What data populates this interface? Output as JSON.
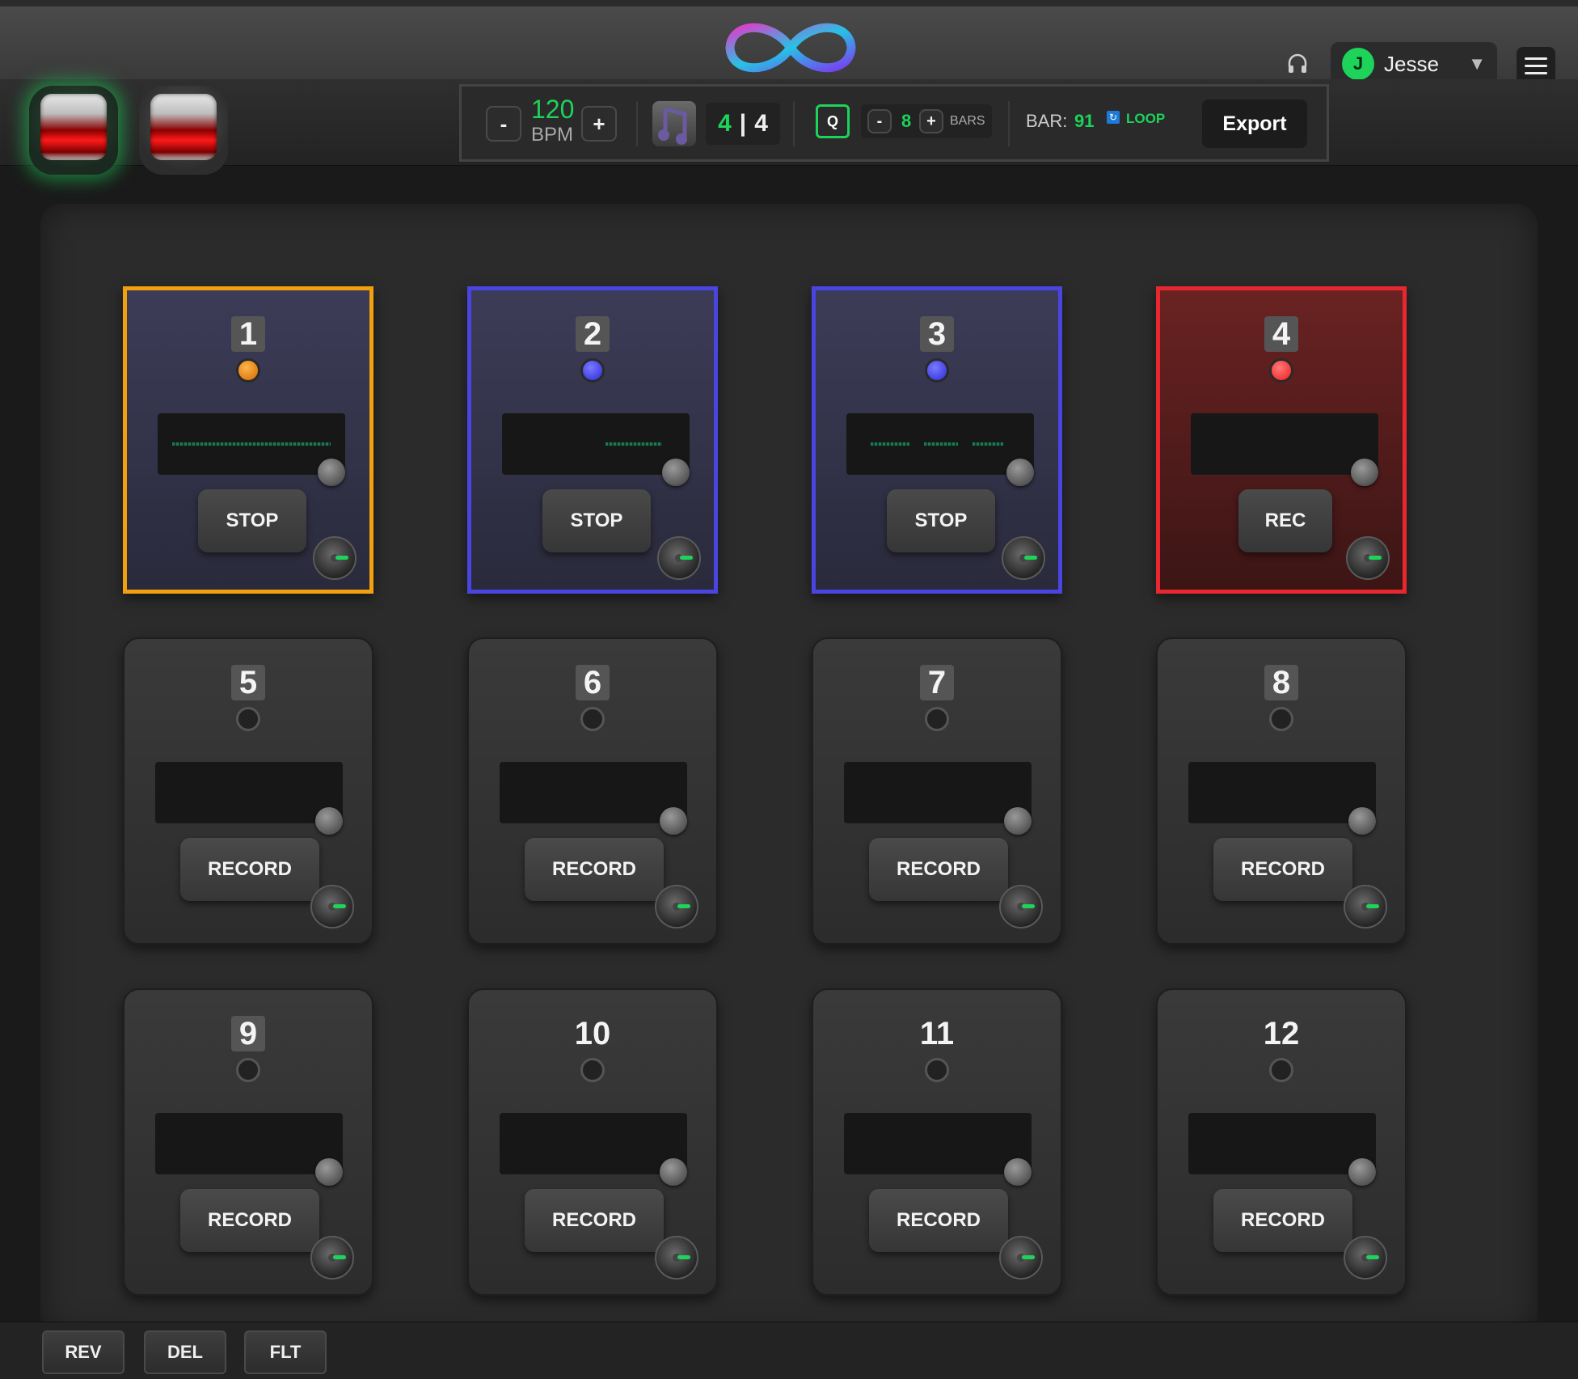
{
  "colors": {
    "accent_green": "#1dd35a",
    "orange": "#f1a10d",
    "blue": "#4a45e0",
    "red": "#e7282f"
  },
  "header": {
    "logo_icon": "infinity-icon",
    "headphones_icon": "headphones-icon",
    "user": {
      "avatar_letter": "J",
      "name": "Jesse",
      "caret": "▼"
    },
    "menu_icon": "hamburger-icon"
  },
  "transport": {
    "bpm_minus": "-",
    "bpm_value": "120",
    "bpm_label": "BPM",
    "bpm_plus": "+",
    "metronome_icon": "music-note-icon",
    "time_sig_top": "4",
    "time_sig_sep": "|",
    "time_sig_bottom": "4",
    "quantize": "Q",
    "bars_minus": "-",
    "bars_value": "8",
    "bars_plus": "+",
    "bars_label": "BARS",
    "bar_label": "BAR:",
    "bar_value": "91",
    "loop_label": "LOOP",
    "export": "Export"
  },
  "loops": [
    {
      "num": "1",
      "action": "STOP",
      "state": "orange"
    },
    {
      "num": "2",
      "action": "STOP",
      "state": "blue"
    },
    {
      "num": "3",
      "action": "STOP",
      "state": "blue"
    },
    {
      "num": "4",
      "action": "REC",
      "state": "red"
    },
    {
      "num": "5",
      "action": "RECORD",
      "state": "idle"
    },
    {
      "num": "6",
      "action": "RECORD",
      "state": "idle"
    },
    {
      "num": "7",
      "action": "RECORD",
      "state": "idle"
    },
    {
      "num": "8",
      "action": "RECORD",
      "state": "idle"
    },
    {
      "num": "9",
      "action": "RECORD",
      "state": "idle"
    },
    {
      "num": "10",
      "action": "RECORD",
      "state": "idle"
    },
    {
      "num": "11",
      "action": "RECORD",
      "state": "idle"
    },
    {
      "num": "12",
      "action": "RECORD",
      "state": "idle"
    }
  ],
  "effects": [
    "REV",
    "DEL",
    "FLT"
  ]
}
